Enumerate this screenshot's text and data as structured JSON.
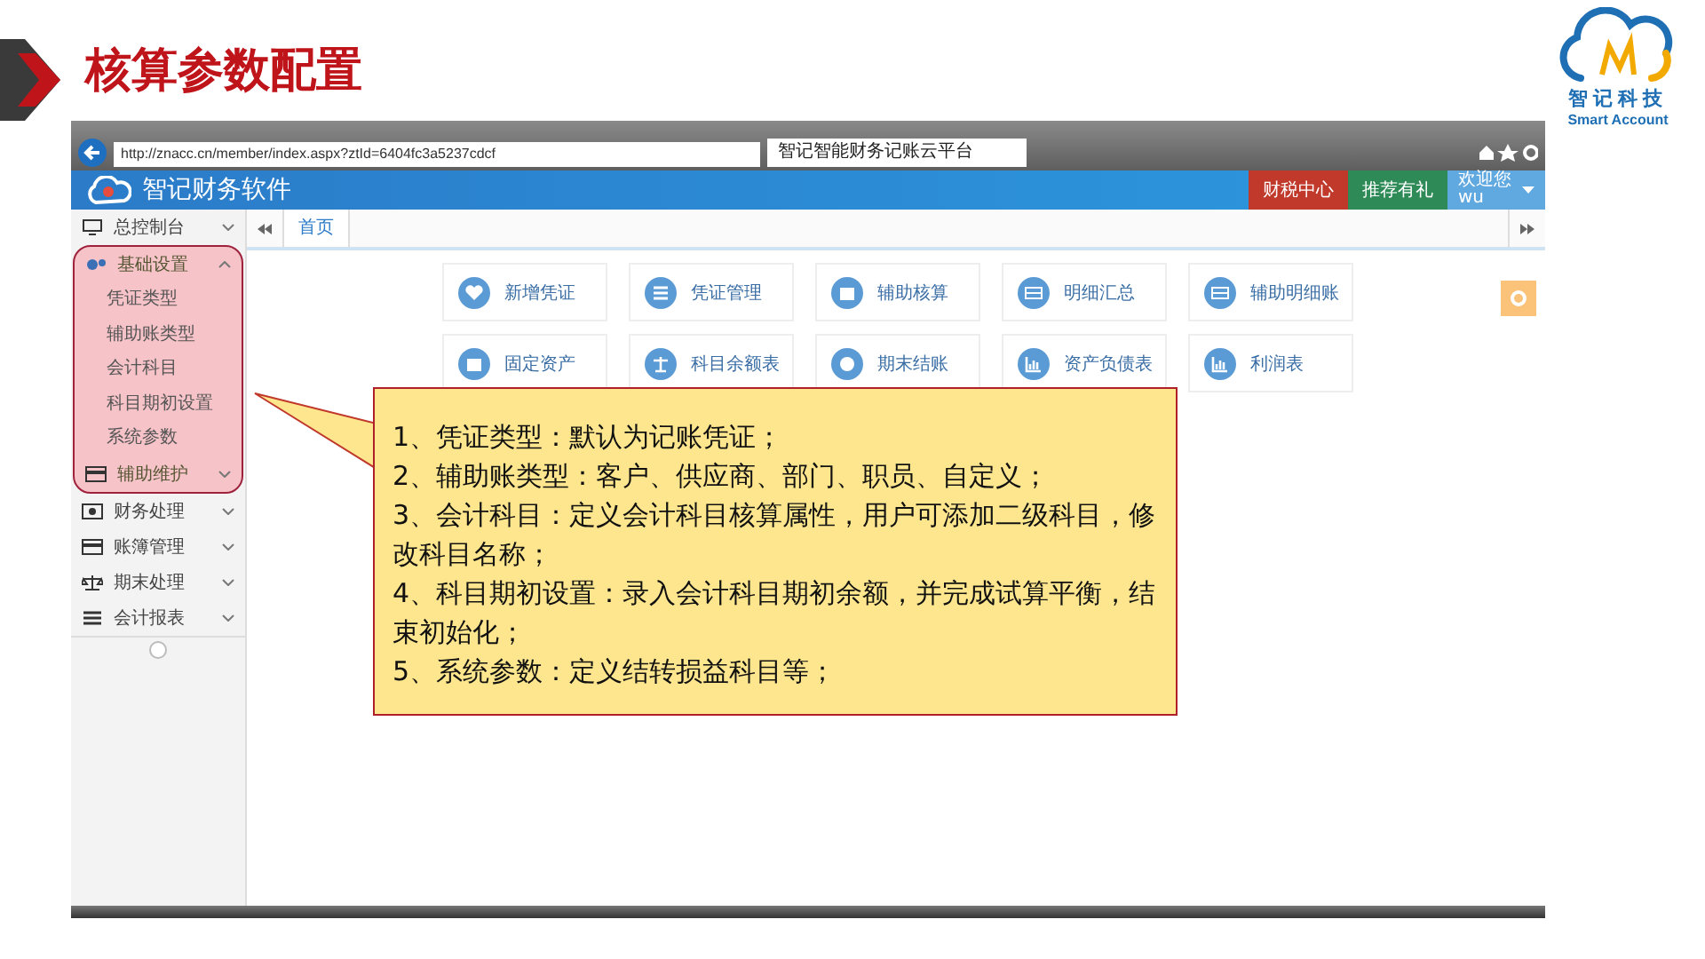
{
  "slide": {
    "title": "核算参数配置",
    "logo": {
      "name": "智记科技",
      "tagline": "Smart Account"
    }
  },
  "browser": {
    "url": "http://znacc.cn/member/index.aspx?ztId=6404fc3a5237cdcf",
    "tab_title": "智记智能财务记账云平台"
  },
  "app": {
    "name": "智记财务软件",
    "header_buttons": [
      {
        "label": "财税中心",
        "color": "#c0392b"
      },
      {
        "label": "推荐有礼",
        "color": "#2e8b57"
      }
    ],
    "user": {
      "greeting": "欢迎您",
      "name": "wu"
    }
  },
  "tabs": [
    {
      "label": "首页",
      "selected": true
    }
  ],
  "sidebar": {
    "items": [
      {
        "label": "总控制台",
        "highlighted": false,
        "expanded": false
      },
      {
        "label": "基础设置",
        "highlighted": true,
        "expanded": true,
        "children": [
          {
            "label": "凭证类型"
          },
          {
            "label": "辅助账类型"
          },
          {
            "label": "会计科目"
          },
          {
            "label": "科目期初设置"
          },
          {
            "label": "系统参数"
          }
        ]
      },
      {
        "label": "辅助维护",
        "highlighted": true,
        "expanded": false
      },
      {
        "label": "财务处理",
        "highlighted": false,
        "expanded": false
      },
      {
        "label": "账簿管理",
        "highlighted": false,
        "expanded": false
      },
      {
        "label": "期末处理",
        "highlighted": false,
        "expanded": false
      },
      {
        "label": "会计报表",
        "highlighted": false,
        "expanded": false
      }
    ]
  },
  "tiles": [
    {
      "label": "新增凭证"
    },
    {
      "label": "凭证管理"
    },
    {
      "label": "辅助核算"
    },
    {
      "label": "明细汇总"
    },
    {
      "label": "辅助明细账"
    },
    {
      "label": "固定资产"
    },
    {
      "label": "科目余额表"
    },
    {
      "label": "期末结账"
    },
    {
      "label": "资产负债表"
    },
    {
      "label": "利润表"
    }
  ],
  "callout": {
    "lines": [
      "1、凭证类型：默认为记账凭证；",
      "2、辅助账类型：客户、供应商、部门、职员、自定义；",
      "3、会计科目：定义会计科目核算属性，用户可添加二级科目，修改科目名称；",
      "4、科目期初设置：录入会计科目期初余额，并完成试算平衡，结束初始化；",
      "5、系统参数：定义结转损益科目等；"
    ]
  }
}
